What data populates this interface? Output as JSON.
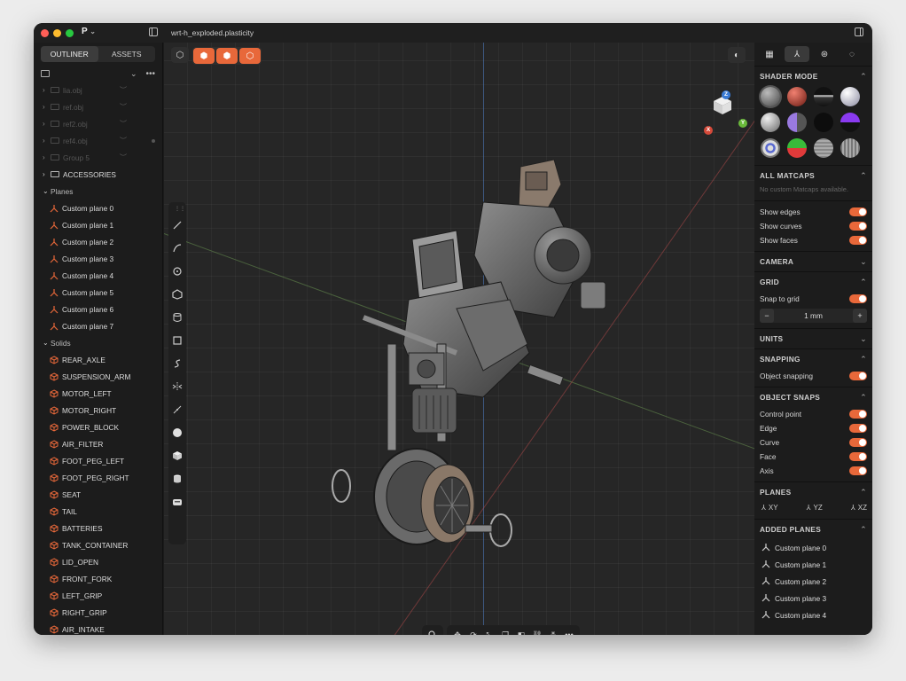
{
  "titlebar": {
    "app_logo": "P",
    "logo_caret": "⌄",
    "filename": "wrt-h_exploded.plasticity"
  },
  "sidebar": {
    "tabs": [
      {
        "label": "OUTLINER"
      },
      {
        "label": "ASSETS"
      }
    ],
    "hidden_items": [
      {
        "label": "lia.obj"
      },
      {
        "label": "ref.obj"
      },
      {
        "label": "ref2.obj"
      },
      {
        "label": "ref4.obj"
      },
      {
        "label": "Group 5"
      }
    ],
    "folders": [
      {
        "label": "ACCESSORIES"
      }
    ],
    "planes_label": "Planes",
    "planes": [
      {
        "label": "Custom plane 0"
      },
      {
        "label": "Custom plane 1"
      },
      {
        "label": "Custom plane 2"
      },
      {
        "label": "Custom plane 3"
      },
      {
        "label": "Custom plane 4"
      },
      {
        "label": "Custom plane 5"
      },
      {
        "label": "Custom plane 6"
      },
      {
        "label": "Custom plane 7"
      }
    ],
    "solids_label": "Solids",
    "solids": [
      {
        "label": "REAR_AXLE"
      },
      {
        "label": "SUSPENSION_ARM"
      },
      {
        "label": "MOTOR_LEFT"
      },
      {
        "label": "MOTOR_RIGHT"
      },
      {
        "label": "POWER_BLOCK"
      },
      {
        "label": "AIR_FILTER"
      },
      {
        "label": "FOOT_PEG_LEFT"
      },
      {
        "label": "FOOT_PEG_RIGHT"
      },
      {
        "label": "SEAT"
      },
      {
        "label": "TAIL"
      },
      {
        "label": "BATTERIES"
      },
      {
        "label": "TANK_CONTAINER"
      },
      {
        "label": "LID_OPEN"
      },
      {
        "label": "FRONT_FORK"
      },
      {
        "label": "LEFT_GRIP"
      },
      {
        "label": "RIGHT_GRIP"
      },
      {
        "label": "AIR_INTAKE"
      }
    ]
  },
  "viewport": {
    "gizmo": {
      "z": "Z",
      "x": "X",
      "y": "Y"
    },
    "colors": {
      "accent": "#e8683a",
      "axis_x": "#d54a3a",
      "axis_y": "#6aba3a",
      "axis_z": "#3a7bd5"
    }
  },
  "right_panel": {
    "shader_mode": {
      "title": "SHADER MODE"
    },
    "matcaps": {
      "title": "ALL MATCAPS",
      "empty_text": "No custom Matcaps available."
    },
    "display_toggles": [
      {
        "label": "Show edges"
      },
      {
        "label": "Show curves"
      },
      {
        "label": "Show faces"
      }
    ],
    "camera": {
      "title": "CAMERA"
    },
    "grid": {
      "title": "GRID",
      "snap_label": "Snap to grid",
      "value": "1 mm",
      "minus": "−",
      "plus": "+"
    },
    "units": {
      "title": "UNITS"
    },
    "snapping": {
      "title": "SNAPPING",
      "object_label": "Object snapping"
    },
    "object_snaps": {
      "title": "OBJECT SNAPS",
      "items": [
        {
          "label": "Control point"
        },
        {
          "label": "Edge"
        },
        {
          "label": "Curve"
        },
        {
          "label": "Face"
        },
        {
          "label": "Axis"
        }
      ]
    },
    "planes": {
      "title": "PLANES",
      "items": [
        {
          "label": "XY"
        },
        {
          "label": "YZ"
        },
        {
          "label": "XZ"
        }
      ]
    },
    "added_planes": {
      "title": "ADDED PLANES",
      "items": [
        {
          "label": "Custom plane 0"
        },
        {
          "label": "Custom plane 1"
        },
        {
          "label": "Custom plane 2"
        },
        {
          "label": "Custom plane 3"
        },
        {
          "label": "Custom plane 4"
        }
      ]
    }
  }
}
